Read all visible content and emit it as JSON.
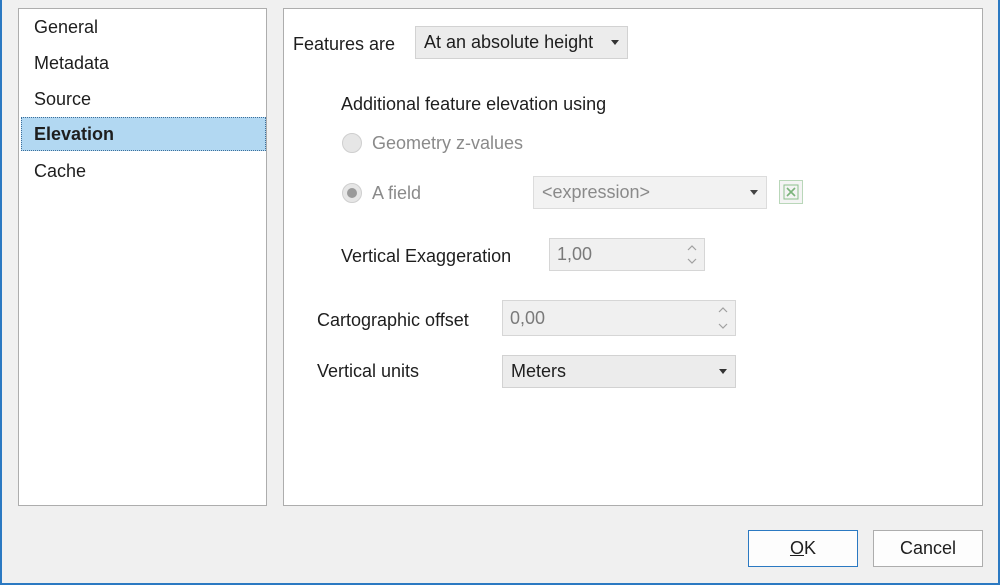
{
  "nav": {
    "items": [
      {
        "label": "General",
        "selected": false
      },
      {
        "label": "Metadata",
        "selected": false
      },
      {
        "label": "Source",
        "selected": false
      },
      {
        "label": "Elevation",
        "selected": true
      },
      {
        "label": "Cache",
        "selected": false
      }
    ]
  },
  "elevation": {
    "features_are_label": "Features are",
    "features_are_value": "At an absolute height",
    "additional_heading": "Additional feature elevation using",
    "radio_geometry_label": "Geometry z-values",
    "radio_field_label": "A field",
    "field_value": "<expression>",
    "vertical_exaggeration_label": "Vertical Exaggeration",
    "vertical_exaggeration_value": "1,00",
    "cartographic_offset_label": "Cartographic offset",
    "cartographic_offset_value": "0,00",
    "vertical_units_label": "Vertical units",
    "vertical_units_value": "Meters"
  },
  "footer": {
    "ok_accel": "O",
    "ok_rest": "K",
    "cancel_label": "Cancel"
  },
  "icons": {
    "clear_expression": "excel-clear-icon",
    "spin_up": "chevron-up-icon",
    "spin_down": "chevron-down-icon",
    "dropdown": "caret-down-icon"
  },
  "colors": {
    "accent": "#2b79c2",
    "selection": "#b2d8f2"
  }
}
